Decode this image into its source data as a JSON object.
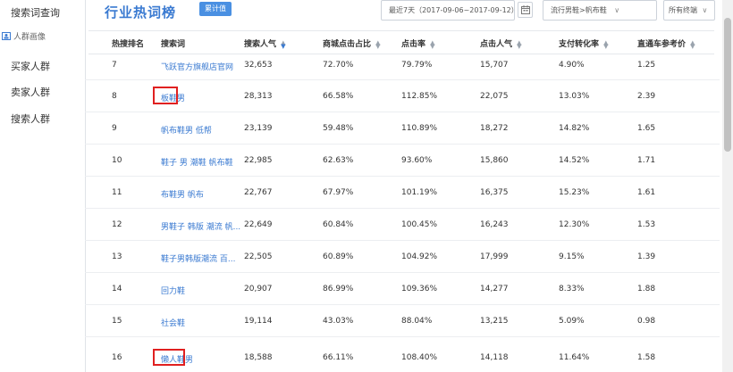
{
  "sidebar": {
    "top_item": "搜索词查询",
    "group_label": "人群画像",
    "items": [
      "买家人群",
      "卖家人群",
      "搜索人群"
    ]
  },
  "header": {
    "title": "行业热词榜",
    "badge": "累计值",
    "date_range": "最近7天（2017-09-06~2017-09-12）",
    "category": "流行男鞋>帆布鞋",
    "terminal": "所有终端"
  },
  "columns": [
    "热搜排名",
    "搜索词",
    "搜索人气",
    "商城点击占比",
    "点击率",
    "点击人气",
    "支付转化率",
    "直通车参考价"
  ],
  "rows": [
    {
      "rank": "7",
      "keyword": "飞跃官方旗舰店官网",
      "pop": "32,653",
      "mall": "72.70%",
      "ctr": "79.79%",
      "click_pop": "15,707",
      "conv": "4.90%",
      "price": "1.25"
    },
    {
      "rank": "8",
      "keyword": "板鞋男",
      "pop": "28,313",
      "mall": "66.58%",
      "ctr": "112.85%",
      "click_pop": "22,075",
      "conv": "13.03%",
      "price": "2.39"
    },
    {
      "rank": "9",
      "keyword": "帆布鞋男 低帮",
      "pop": "23,139",
      "mall": "59.48%",
      "ctr": "110.89%",
      "click_pop": "18,272",
      "conv": "14.82%",
      "price": "1.65"
    },
    {
      "rank": "10",
      "keyword": "鞋子 男 潮鞋 帆布鞋",
      "pop": "22,985",
      "mall": "62.63%",
      "ctr": "93.60%",
      "click_pop": "15,860",
      "conv": "14.52%",
      "price": "1.71"
    },
    {
      "rank": "11",
      "keyword": "布鞋男 帆布",
      "pop": "22,767",
      "mall": "67.97%",
      "ctr": "101.19%",
      "click_pop": "16,375",
      "conv": "15.23%",
      "price": "1.61"
    },
    {
      "rank": "12",
      "keyword": "男鞋子 韩版 潮流 帆...",
      "pop": "22,649",
      "mall": "60.84%",
      "ctr": "100.45%",
      "click_pop": "16,243",
      "conv": "12.30%",
      "price": "1.53"
    },
    {
      "rank": "13",
      "keyword": "鞋子男韩版潮流 百...",
      "pop": "22,505",
      "mall": "60.89%",
      "ctr": "104.92%",
      "click_pop": "17,999",
      "conv": "9.15%",
      "price": "1.39"
    },
    {
      "rank": "14",
      "keyword": "回力鞋",
      "pop": "20,907",
      "mall": "86.99%",
      "ctr": "109.36%",
      "click_pop": "14,277",
      "conv": "8.33%",
      "price": "1.88"
    },
    {
      "rank": "15",
      "keyword": "社会鞋",
      "pop": "19,114",
      "mall": "43.03%",
      "ctr": "88.04%",
      "click_pop": "13,215",
      "conv": "5.09%",
      "price": "0.98"
    },
    {
      "rank": "16",
      "keyword": "懒人鞋男",
      "pop": "18,588",
      "mall": "66.11%",
      "ctr": "108.40%",
      "click_pop": "14,118",
      "conv": "11.64%",
      "price": "1.58"
    }
  ],
  "colors": {
    "accent": "#3a7ad1",
    "highlight": "#e02020"
  }
}
